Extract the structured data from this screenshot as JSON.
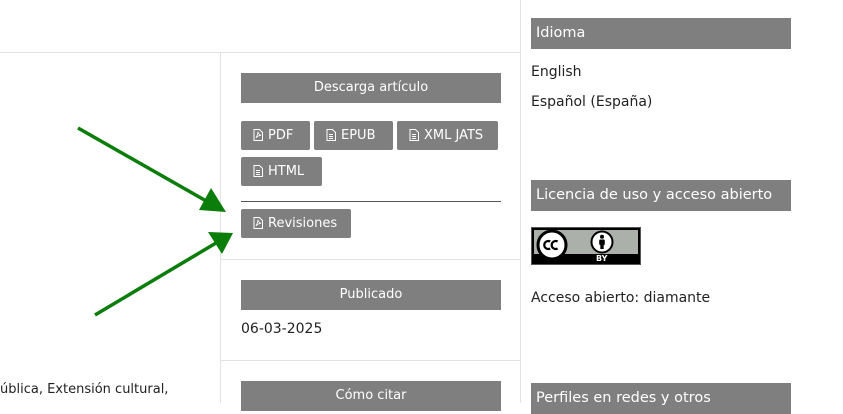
{
  "main": {
    "keywords_fragment": "ública, Extensión cultural,"
  },
  "article_sidebar": {
    "download": {
      "title": "Descarga artículo",
      "galleys": [
        {
          "label": "PDF",
          "icon": "file-pdf-icon"
        },
        {
          "label": "EPUB",
          "icon": "file-text-icon"
        },
        {
          "label": "XML JATS",
          "icon": "file-text-icon"
        },
        {
          "label": "HTML",
          "icon": "file-text-icon"
        }
      ],
      "revisions_label": "Revisiones"
    },
    "published": {
      "title": "Publicado",
      "date": "06-03-2025"
    },
    "citation": {
      "title": "Cómo citar"
    }
  },
  "site_sidebar": {
    "language": {
      "title": "Idioma",
      "options": [
        "English",
        "Español (España)"
      ]
    },
    "license": {
      "title": "Licencia de uso y acceso abierto",
      "badge_text": "BY",
      "open_access": "Acceso abierto: diamante"
    },
    "profiles": {
      "title": "Perfiles en redes y otros"
    }
  },
  "colors": {
    "block_header": "#7f7f7f",
    "annotation_arrow": "#0a7d0a",
    "divider": "#e2e2e2"
  }
}
